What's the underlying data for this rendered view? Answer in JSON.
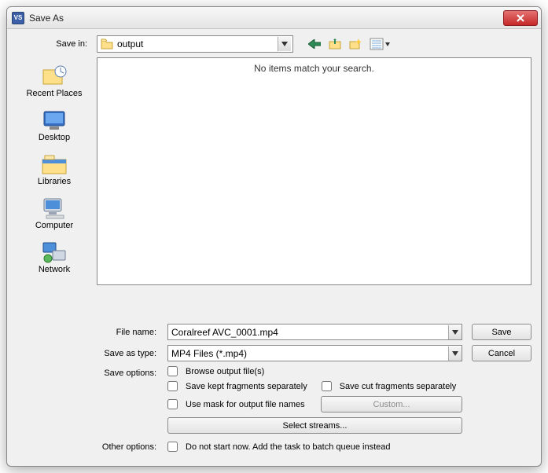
{
  "window": {
    "title": "Save As",
    "app_icon_text": "VS"
  },
  "savein": {
    "label": "Save in:",
    "value": "output"
  },
  "toolbar_icons": [
    "back-icon",
    "up-one-level-icon",
    "new-folder-icon",
    "view-menu-icon"
  ],
  "places": [
    {
      "id": "recent-places",
      "label": "Recent Places"
    },
    {
      "id": "desktop",
      "label": "Desktop"
    },
    {
      "id": "libraries",
      "label": "Libraries"
    },
    {
      "id": "computer",
      "label": "Computer"
    },
    {
      "id": "network",
      "label": "Network"
    }
  ],
  "content": {
    "empty_message": "No items match your search."
  },
  "filename": {
    "label": "File name:",
    "value": "Coralreef AVC_0001.mp4"
  },
  "saveastype": {
    "label": "Save as type:",
    "value": "MP4 Files (*.mp4)"
  },
  "buttons": {
    "save": "Save",
    "cancel": "Cancel",
    "custom": "Custom...",
    "select_streams": "Select streams..."
  },
  "save_options": {
    "label": "Save options:",
    "browse": "Browse output file(s)",
    "save_kept_separately": "Save kept fragments separately",
    "save_cut_separately": "Save cut fragments separately",
    "use_mask": "Use mask for output file names"
  },
  "other_options": {
    "label": "Other options:",
    "batch": "Do not start now. Add the task to batch queue instead"
  }
}
